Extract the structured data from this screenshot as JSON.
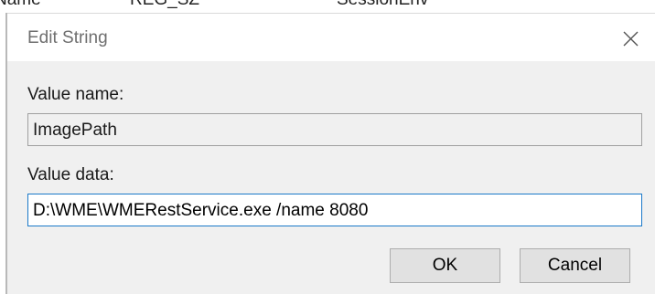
{
  "background_window": {
    "partial_text": [
      "Name",
      "REG_SZ",
      "SessionEnv"
    ]
  },
  "dialog": {
    "title": "Edit String",
    "close_icon": "close-icon"
  },
  "fields": {
    "value_name_label": "Value name:",
    "value_name": "ImagePath",
    "value_data_label": "Value data:",
    "value_data": "D:\\WME\\WMERestService.exe /name 8080"
  },
  "buttons": {
    "ok_label": "OK",
    "cancel_label": "Cancel"
  },
  "colors": {
    "dialog_bg": "#f0f0f0",
    "focus_border": "#1a79c9",
    "title_text": "#6f6f6f"
  }
}
